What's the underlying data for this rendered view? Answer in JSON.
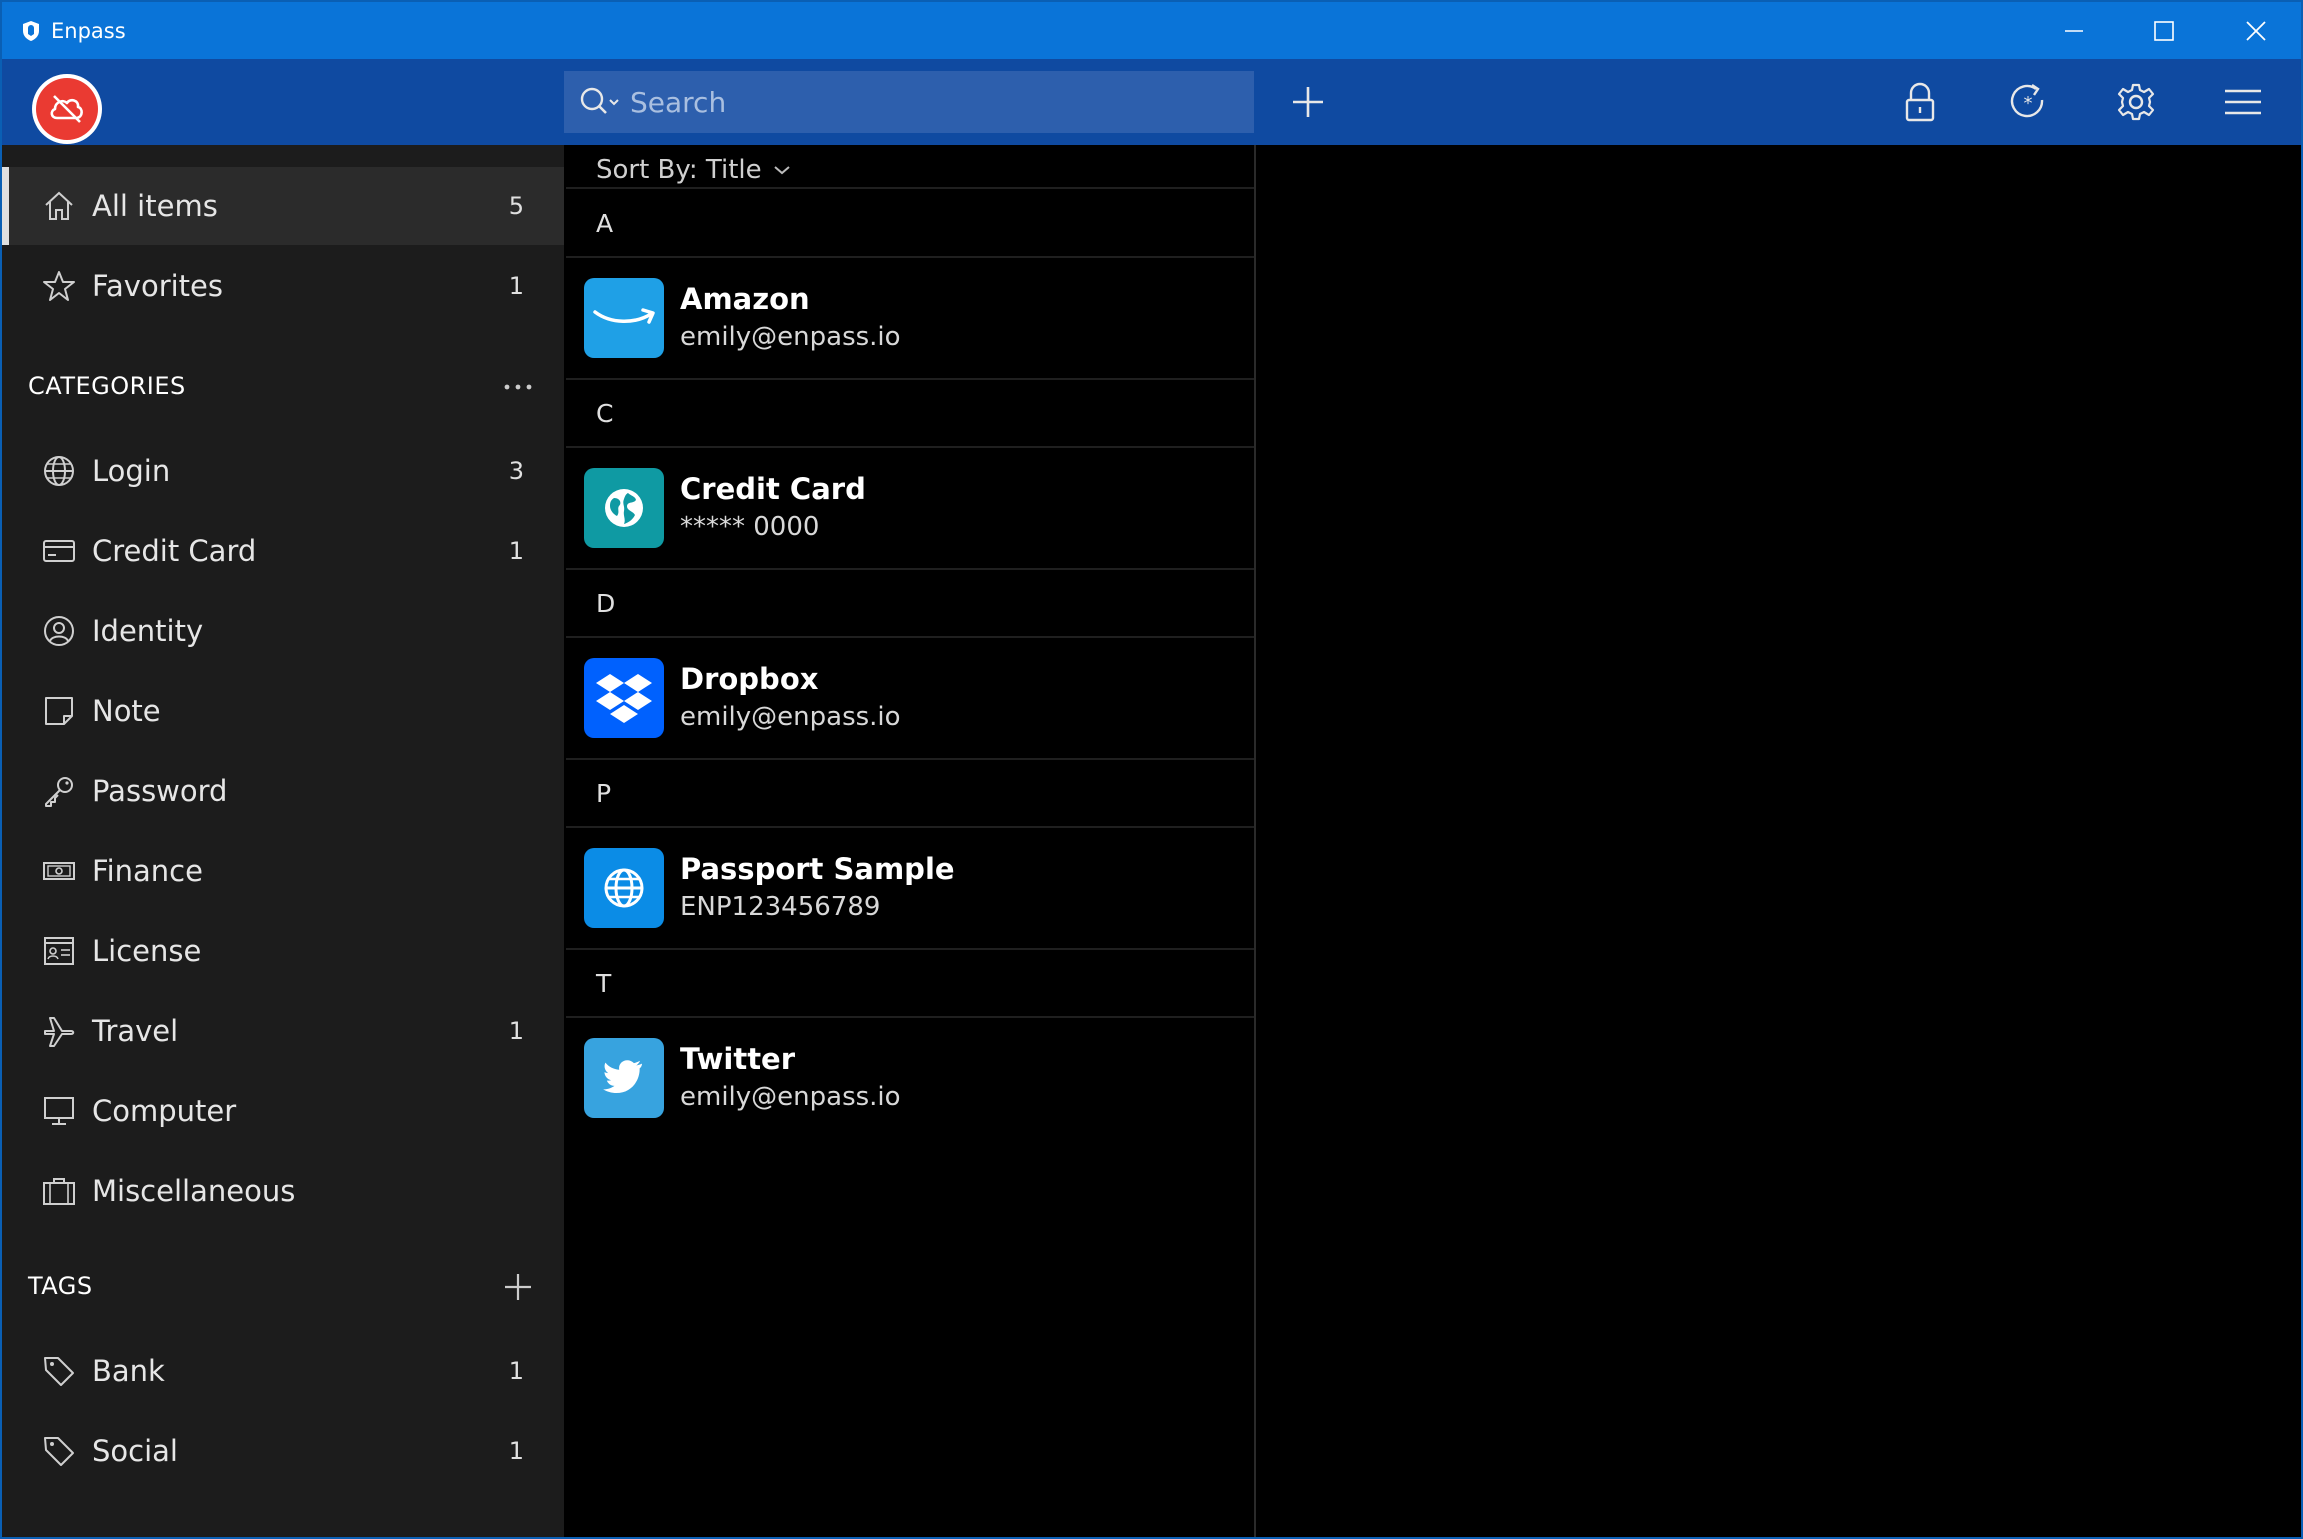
{
  "window": {
    "title": "Enpass"
  },
  "search": {
    "placeholder": "Search"
  },
  "sidebar": {
    "main": [
      {
        "label": "All items",
        "count": "5",
        "icon": "home-icon"
      },
      {
        "label": "Favorites",
        "count": "1",
        "icon": "star-icon"
      }
    ],
    "categories_header": "CATEGORIES",
    "categories": [
      {
        "label": "Login",
        "count": "3",
        "icon": "globe-icon"
      },
      {
        "label": "Credit Card",
        "count": "1",
        "icon": "credit-card-icon"
      },
      {
        "label": "Identity",
        "count": "",
        "icon": "identity-icon"
      },
      {
        "label": "Note",
        "count": "",
        "icon": "note-icon"
      },
      {
        "label": "Password",
        "count": "",
        "icon": "key-icon"
      },
      {
        "label": "Finance",
        "count": "",
        "icon": "banknote-icon"
      },
      {
        "label": "License",
        "count": "",
        "icon": "license-icon"
      },
      {
        "label": "Travel",
        "count": "1",
        "icon": "airplane-icon"
      },
      {
        "label": "Computer",
        "count": "",
        "icon": "monitor-icon"
      },
      {
        "label": "Miscellaneous",
        "count": "",
        "icon": "briefcase-icon"
      }
    ],
    "tags_header": "TAGS",
    "tags": [
      {
        "label": "Bank",
        "count": "1",
        "icon": "tag-icon"
      },
      {
        "label": "Social",
        "count": "1",
        "icon": "tag-icon"
      }
    ]
  },
  "list": {
    "sort_label": "Sort By: Title",
    "groups": [
      {
        "letter": "A",
        "title": "Amazon",
        "subtitle": "emily@enpass.io",
        "icon": "amazon-icon",
        "color": "#1fa0e6"
      },
      {
        "letter": "C",
        "title": "Credit Card",
        "subtitle": "***** 0000",
        "icon": "globe-card-icon",
        "color": "#0f9aa3"
      },
      {
        "letter": "D",
        "title": "Dropbox",
        "subtitle": "emily@enpass.io",
        "icon": "dropbox-icon",
        "color": "#0061fe"
      },
      {
        "letter": "P",
        "title": "Passport Sample",
        "subtitle": "ENP123456789",
        "icon": "globe-icon",
        "color": "#0b8ce6"
      },
      {
        "letter": "T",
        "title": "Twitter",
        "subtitle": "emily@enpass.io",
        "icon": "twitter-icon",
        "color": "#37a3df"
      }
    ]
  },
  "colors": {
    "titlebar": "#0a74d8",
    "toolbar": "#0f4aa1",
    "sync": "#ea3a32",
    "sidebar": "#1c1c1c"
  }
}
